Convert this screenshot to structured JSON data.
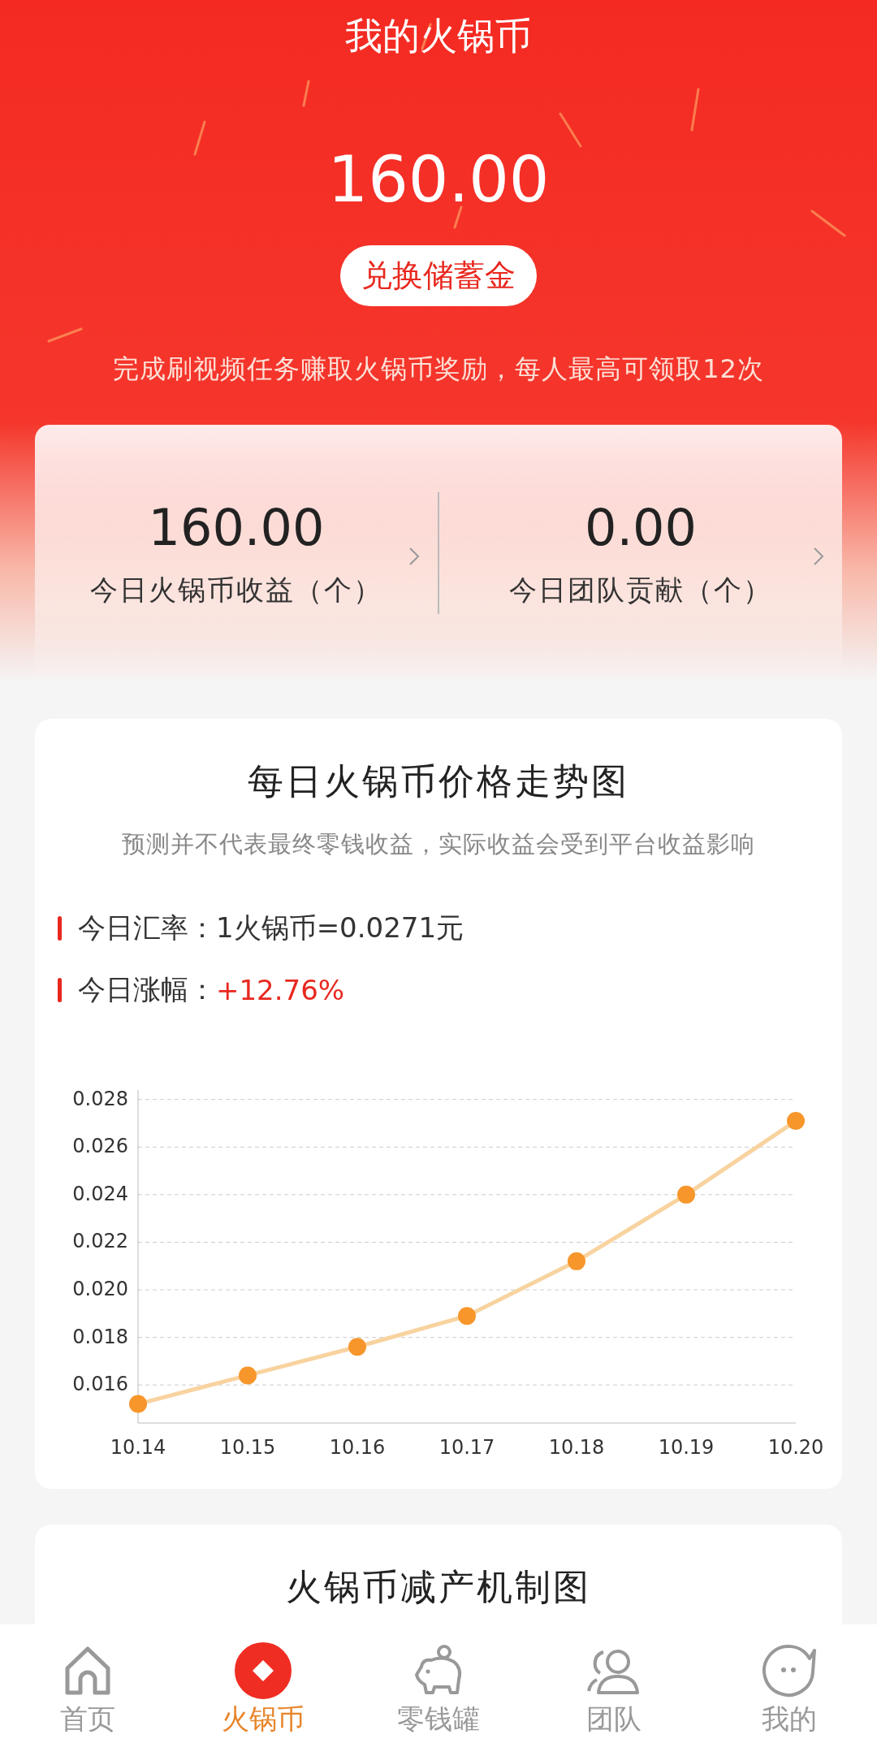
{
  "header": {
    "title": "我的火锅币",
    "balance": "160.00",
    "exchange_button": "兑换储蓄金",
    "note": "完成刷视频任务赚取火锅币奖励，每人最高可领取12次"
  },
  "stats": [
    {
      "value": "160.00",
      "label": "今日火锅币收益（个）"
    },
    {
      "value": "0.00",
      "label": "今日团队贡献（个）"
    }
  ],
  "price_card": {
    "title": "每日火锅币价格走势图",
    "subtitle": "预测并不代表最终零钱收益，实际收益会受到平台收益影响",
    "rates": [
      {
        "label": "今日汇率：",
        "value": "1火锅币=0.0271元",
        "kind": "plain"
      },
      {
        "label": "今日涨幅：",
        "value": "+12.76%",
        "kind": "change"
      }
    ],
    "chart_data": {
      "type": "line",
      "categories": [
        "10.14",
        "10.15",
        "10.16",
        "10.17",
        "10.18",
        "10.19",
        "10.20"
      ],
      "series": [
        {
          "color": "#f7962a",
          "marker": true,
          "values": [
            0.0152,
            0.0164,
            0.0176,
            0.0189,
            0.0212,
            0.024,
            0.0271
          ]
        }
      ],
      "grid": true,
      "ylim": [
        0.0144,
        0.0284
      ],
      "yticks": [
        {
          "value": 0.016,
          "label": "0.016"
        },
        {
          "value": 0.018,
          "label": "0.018"
        },
        {
          "value": 0.02,
          "label": "0.020"
        },
        {
          "value": 0.022,
          "label": "0.022"
        },
        {
          "value": 0.024,
          "label": "0.024"
        },
        {
          "value": 0.026,
          "label": "0.026"
        },
        {
          "value": 0.028,
          "label": "0.028"
        }
      ]
    }
  },
  "reduction_card": {
    "title": "火锅币减产机制图"
  },
  "nav": [
    {
      "label": "首页",
      "kind": "home",
      "selected": false
    },
    {
      "label": "火锅币",
      "kind": "coin",
      "selected": true
    },
    {
      "label": "零钱罐",
      "kind": "piggy",
      "selected": false
    },
    {
      "label": "团队",
      "kind": "team",
      "selected": false
    },
    {
      "label": "我的",
      "kind": "me",
      "selected": false
    }
  ]
}
